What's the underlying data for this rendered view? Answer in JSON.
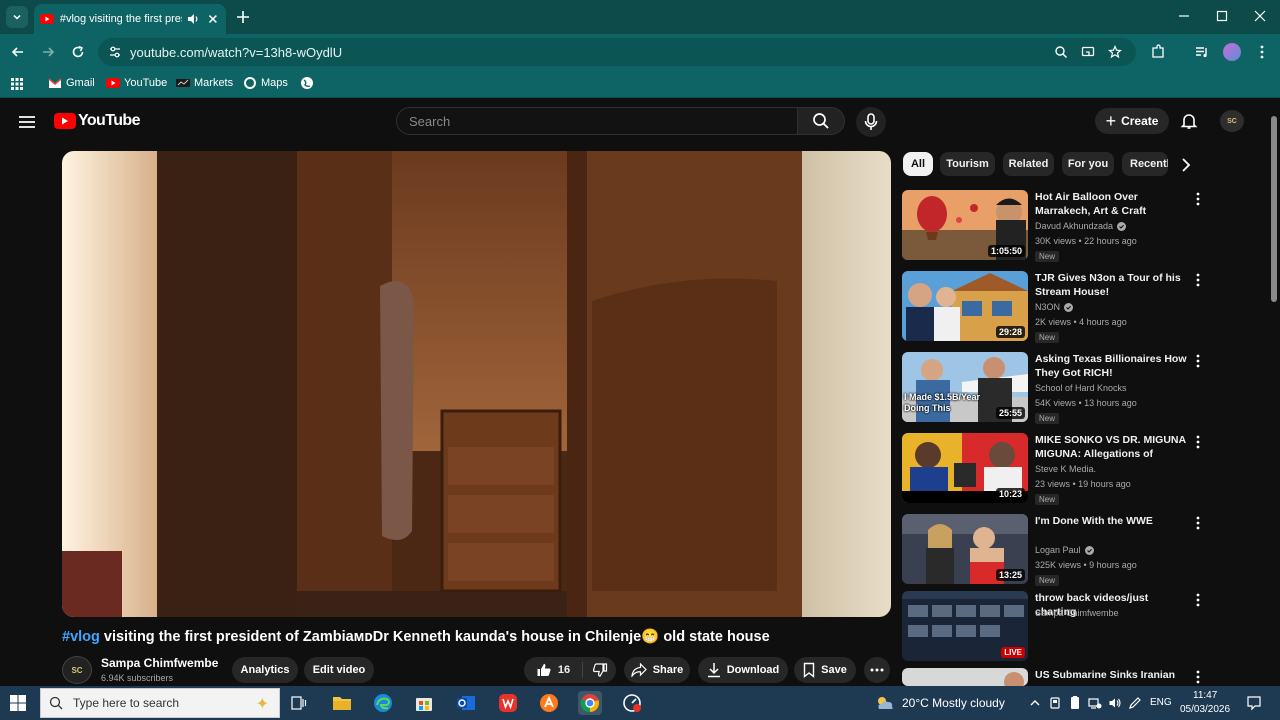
{
  "browser": {
    "tab_title": "#vlog visiting the first president of Zambia",
    "url": "youtube.com/watch?v=13h8-wOydlU",
    "bookmarks": [
      {
        "label": "Gmail",
        "icon": "gmail-icon"
      },
      {
        "label": "YouTube",
        "icon": "youtube-icon"
      },
      {
        "label": "Markets",
        "icon": "markets-icon"
      },
      {
        "label": "Maps",
        "icon": "maps-icon"
      }
    ]
  },
  "youtube": {
    "logo_text": "YouTube",
    "search_placeholder": "Search",
    "create_label": "Create",
    "user_avatar_initials": "SC"
  },
  "video": {
    "title_hashtag": "#vlog",
    "title_rest": " visiting the first president of ZambiaᴍᴅDr Kenneth kaunda's house in Chilenje😁 old state house",
    "channel": {
      "name": "Sampa Chimfwembe",
      "subscribers": "6.94K subscribers",
      "avatar_initials": "SC"
    },
    "actions": {
      "analytics": "Analytics",
      "edit_video": "Edit video",
      "likes": "16",
      "share": "Share",
      "download": "Download",
      "save": "Save"
    }
  },
  "chips": [
    "All",
    "Tourism",
    "Related",
    "For you",
    "Recently uploaded"
  ],
  "recommendations": [
    {
      "title": "Hot Air Balloon Over Marrakech, Art & Craft Shopping In Old ...",
      "channel": "Davud Akhundzada",
      "verified": true,
      "meta": "30K views • 22 hours ago",
      "badge": "New",
      "duration": "1:05:50"
    },
    {
      "title": "TJR Gives N3on a Tour of his Stream House!",
      "channel": "N3ON",
      "verified": true,
      "meta": "2K views • 4 hours ago",
      "badge": "New",
      "duration": "29:28"
    },
    {
      "title": "Asking Texas Billionaires How They Got RICH!",
      "channel": "School of Hard Knocks",
      "verified": false,
      "meta": "54K views • 13 hours ago",
      "badge": "New",
      "duration": "25:55",
      "thumb_text": "I Made $1.5B/Year Doing This"
    },
    {
      "title": "MIKE SONKO VS DR. MIGUNA MIGUNA: Allegations of Millio...",
      "channel": "Steve K Media.",
      "verified": false,
      "meta": "23 views • 19 hours ago",
      "badge": "New",
      "duration": "10:23"
    },
    {
      "title": "I'm Done With the WWE",
      "channel": "Logan Paul",
      "verified": true,
      "meta": "325K views • 9 hours ago",
      "badge": "New",
      "duration": "13:25"
    },
    {
      "title": "throw back videos/just charting",
      "channel": "Sampa Chimfwembe",
      "verified": false,
      "meta": "",
      "badge": "",
      "live": "LIVE"
    },
    {
      "title": "US Submarine Sinks Iranian",
      "channel": "",
      "verified": false,
      "meta": "",
      "badge": ""
    }
  ],
  "taskbar": {
    "search_placeholder": "Type here to search",
    "weather": "20°C  Mostly cloudy",
    "language": "ENG",
    "time": "11:47",
    "date": "05/03/2026"
  }
}
